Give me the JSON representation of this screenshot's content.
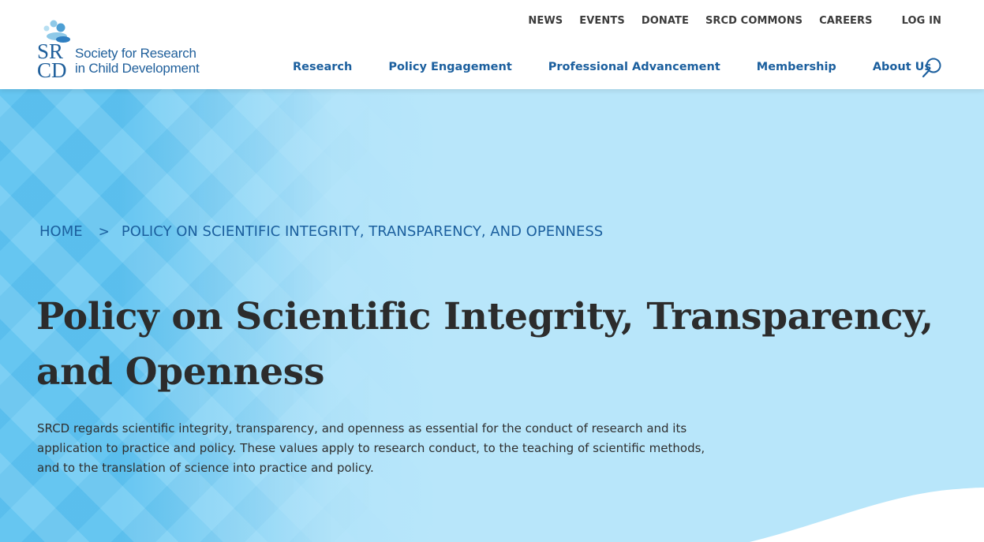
{
  "logo": {
    "abbr_top": "SR",
    "abbr_bottom": "CD",
    "line1": "Society for Research",
    "line2": "in Child Development"
  },
  "utility_nav": [
    "NEWS",
    "EVENTS",
    "DONATE",
    "SRCD COMMONS",
    "CAREERS"
  ],
  "login_label": "LOG IN",
  "main_nav": [
    "Research",
    "Policy Engagement",
    "Professional Advancement",
    "Membership",
    "About Us"
  ],
  "icons": {
    "search": "search-icon",
    "breadcrumb_separator": "chevron-right-icon"
  },
  "breadcrumb": {
    "home": "HOME",
    "separator": ">",
    "current": "POLICY ON SCIENTIFIC INTEGRITY, TRANSPARENCY, AND OPENNESS"
  },
  "page": {
    "title": "Policy on Scientific Integrity, Transparency, and Openness",
    "intro": "SRCD regards scientific integrity, transparency, and openness as essential for the conduct of research and its application to practice and policy. These values apply to research conduct, to the teaching of scientific methods, and to the translation of science into practice and policy."
  },
  "colors": {
    "nav_blue": "#1b5f9e",
    "utility_text": "#3b3b3b",
    "hero_light": "#b8e6fa",
    "hero_dark": "#5ec3f1",
    "title_text": "#2c2c2c"
  }
}
